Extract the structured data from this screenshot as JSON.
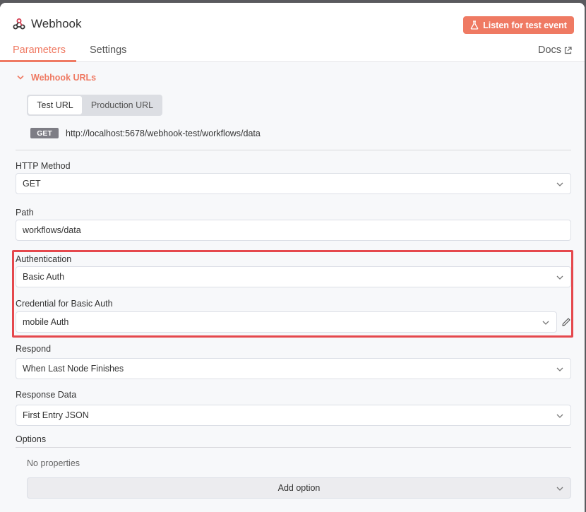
{
  "header": {
    "title": "Webhook",
    "listen_button": "Listen for test event",
    "tabs": [
      "Parameters",
      "Settings",
      "Docs"
    ]
  },
  "webhook_urls": {
    "section_title": "Webhook URLs",
    "url_tabs": [
      "Test URL",
      "Production URL"
    ],
    "method": "GET",
    "url": "http://localhost:5678/webhook-test/workflows/data"
  },
  "fields": {
    "http_method": {
      "label": "HTTP Method",
      "value": "GET"
    },
    "path": {
      "label": "Path",
      "value": "workflows/data"
    },
    "authentication": {
      "label": "Authentication",
      "value": "Basic Auth"
    },
    "credential": {
      "label": "Credential for Basic Auth",
      "value": "mobile Auth"
    },
    "respond": {
      "label": "Respond",
      "value": "When Last Node Finishes"
    },
    "response_data": {
      "label": "Response Data",
      "value": "First Entry JSON"
    }
  },
  "options": {
    "label": "Options",
    "empty_text": "No properties",
    "add_button": "Add option"
  },
  "colors": {
    "accent": "#ef7a63",
    "highlight": "#e5484d"
  }
}
